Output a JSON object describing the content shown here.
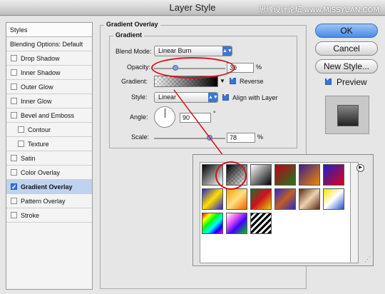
{
  "window": {
    "title": "Layer Style",
    "watermark": "思缘设计论坛 www.MISSYUAN.COM"
  },
  "sidebar": {
    "header": "Styles",
    "items": [
      {
        "label": "Blending Options: Default",
        "checkbox": false,
        "checked": false,
        "sub": false,
        "selected": false,
        "header": true
      },
      {
        "label": "Drop Shadow",
        "checkbox": true,
        "checked": false,
        "sub": false,
        "selected": false
      },
      {
        "label": "Inner Shadow",
        "checkbox": true,
        "checked": false,
        "sub": false,
        "selected": false
      },
      {
        "label": "Outer Glow",
        "checkbox": true,
        "checked": false,
        "sub": false,
        "selected": false
      },
      {
        "label": "Inner Glow",
        "checkbox": true,
        "checked": false,
        "sub": false,
        "selected": false
      },
      {
        "label": "Bevel and Emboss",
        "checkbox": true,
        "checked": false,
        "sub": false,
        "selected": false
      },
      {
        "label": "Contour",
        "checkbox": true,
        "checked": false,
        "sub": true,
        "selected": false
      },
      {
        "label": "Texture",
        "checkbox": true,
        "checked": false,
        "sub": true,
        "selected": false
      },
      {
        "label": "Satin",
        "checkbox": true,
        "checked": false,
        "sub": false,
        "selected": false
      },
      {
        "label": "Color Overlay",
        "checkbox": true,
        "checked": false,
        "sub": false,
        "selected": false
      },
      {
        "label": "Gradient Overlay",
        "checkbox": true,
        "checked": true,
        "sub": false,
        "selected": true
      },
      {
        "label": "Pattern Overlay",
        "checkbox": true,
        "checked": false,
        "sub": false,
        "selected": false
      },
      {
        "label": "Stroke",
        "checkbox": true,
        "checked": false,
        "sub": false,
        "selected": false
      }
    ]
  },
  "panel": {
    "title": "Gradient Overlay",
    "section": "Gradient",
    "blend_mode_label": "Blend Mode:",
    "blend_mode_value": "Linear Burn",
    "opacity_label": "Opacity:",
    "opacity_value": "30",
    "opacity_percent": 30,
    "percent": "%",
    "gradient_label": "Gradient:",
    "reverse_label": "Reverse",
    "style_label": "Style:",
    "style_value": "Linear",
    "align_label": "Align with Layer",
    "angle_label": "Angle:",
    "angle_value": "90",
    "degree": "°",
    "scale_label": "Scale:",
    "scale_value": "78",
    "scale_percent": 78
  },
  "buttons": {
    "ok": "OK",
    "cancel": "Cancel",
    "new_style": "New Style...",
    "preview": "Preview"
  },
  "picker": {
    "swatches": [
      "linear-gradient(135deg,#000 0%,#fff 100%)",
      "linear-gradient(135deg,#000 0%,rgba(0,0,0,0) 100%)",
      "linear-gradient(135deg,#fff 0%,#000 100%)",
      "linear-gradient(135deg,#c0001a 0%,#1d7a1d 100%)",
      "linear-gradient(135deg,#3b1c8f 0%,#f08a00 100%)",
      "linear-gradient(135deg,#1c20c8 0%,#e0001a 100%)",
      "linear-gradient(135deg,#2a20d0 0%,#ffe000 50%,#2a20d0 100%)",
      "linear-gradient(135deg,#f0a000 0%,#ffe080 50%,#f06000 100%)",
      "linear-gradient(135deg,#1c6f2a 0%,#d01020 50%,#e8d000 100%)",
      "linear-gradient(135deg,#2a2ad0 0%,#c06020 50%,#2a2ad0 100%)",
      "linear-gradient(135deg,#5a2a10 0%,#f0d0b0 50%,#5a2a10 100%)",
      "linear-gradient(135deg,#ffe000 0%,#fff 50%,#2050d0 100%)",
      "linear-gradient(135deg,#e00000,#ff0,#0f0,#0ff,#00f,#f0f)",
      "linear-gradient(135deg,#fff 0%,#f060f0 30%,#40f 60%,#0c0 100%)",
      "repeating-linear-gradient(135deg,#000 0 3px,#fff 3px 6px)"
    ],
    "menu_glyph": "▶",
    "resize_glyph": "⋰"
  }
}
